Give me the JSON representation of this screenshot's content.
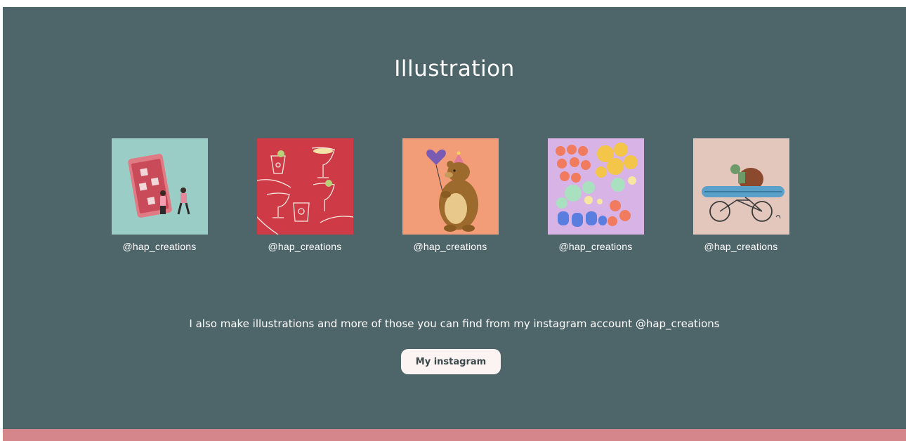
{
  "section": {
    "title": "Illustration",
    "note": "I also  make illustrations and more of those you can find from my instagram account @hap_creations",
    "button_label": "My instagram"
  },
  "gallery": [
    {
      "caption": "@hap_creations",
      "subject": "phone-and-people illustration",
      "bg": "#9bcdc7"
    },
    {
      "caption": "@hap_creations",
      "subject": "cocktail-glasses illustration",
      "bg": "#cf3a47"
    },
    {
      "caption": "@hap_creations",
      "subject": "bear-with-balloon illustration",
      "bg": "#f39d78"
    },
    {
      "caption": "@hap_creations",
      "subject": "flower-pattern illustration",
      "bg": "#d8b4e6"
    },
    {
      "caption": "@hap_creations",
      "subject": "turtle-on-bicycle illustration",
      "bg": "#e3c6bc"
    }
  ],
  "colors": {
    "section_bg": "#4e656a",
    "footer_band": "#d4868a",
    "button_bg": "#fbf4f2",
    "text": "#ffffff"
  }
}
